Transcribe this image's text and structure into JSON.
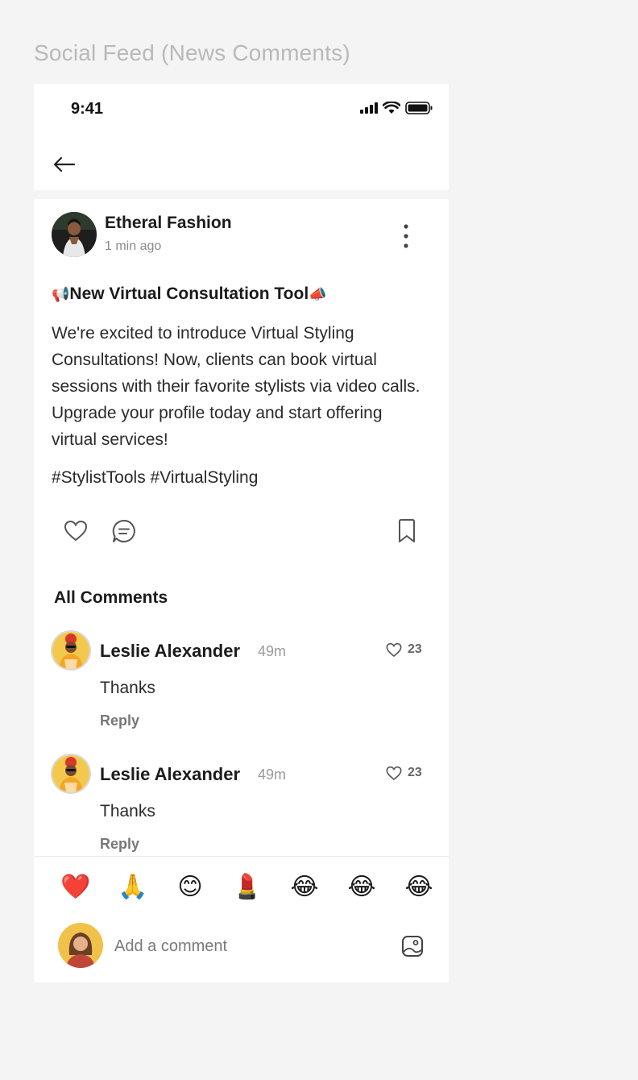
{
  "page": {
    "title": "Social Feed (News Comments)"
  },
  "status_bar": {
    "time": "9:41"
  },
  "post": {
    "author": "Etheral Fashion",
    "time": "1 min ago",
    "title": "New Virtual Consultation Tool",
    "title_emoji_left": "📢",
    "title_emoji_right": "📣",
    "body": "We're excited to introduce Virtual Styling Consultations! Now, clients can book virtual sessions with their favorite stylists via video calls. Upgrade your profile today and start offering virtual services!",
    "hashtags": "#StylistTools #VirtualStyling"
  },
  "comments_section": {
    "title": "All Comments",
    "comments": [
      {
        "author": "Leslie Alexander",
        "time": "49m",
        "likes": "23",
        "text": "Thanks",
        "reply_label": "Reply"
      },
      {
        "author": "Leslie Alexander",
        "time": "49m",
        "likes": "23",
        "text": "Thanks",
        "reply_label": "Reply"
      }
    ]
  },
  "reactions": [
    "❤️",
    "🙏",
    "😊",
    "💄",
    "😂",
    "😂",
    "😂"
  ],
  "composer": {
    "placeholder": "Add a comment"
  },
  "colors": {
    "page_bg": "#f4f4f4",
    "card_bg": "#ffffff",
    "muted": "#8a8a8a",
    "title_gray": "#b9b9b9"
  }
}
